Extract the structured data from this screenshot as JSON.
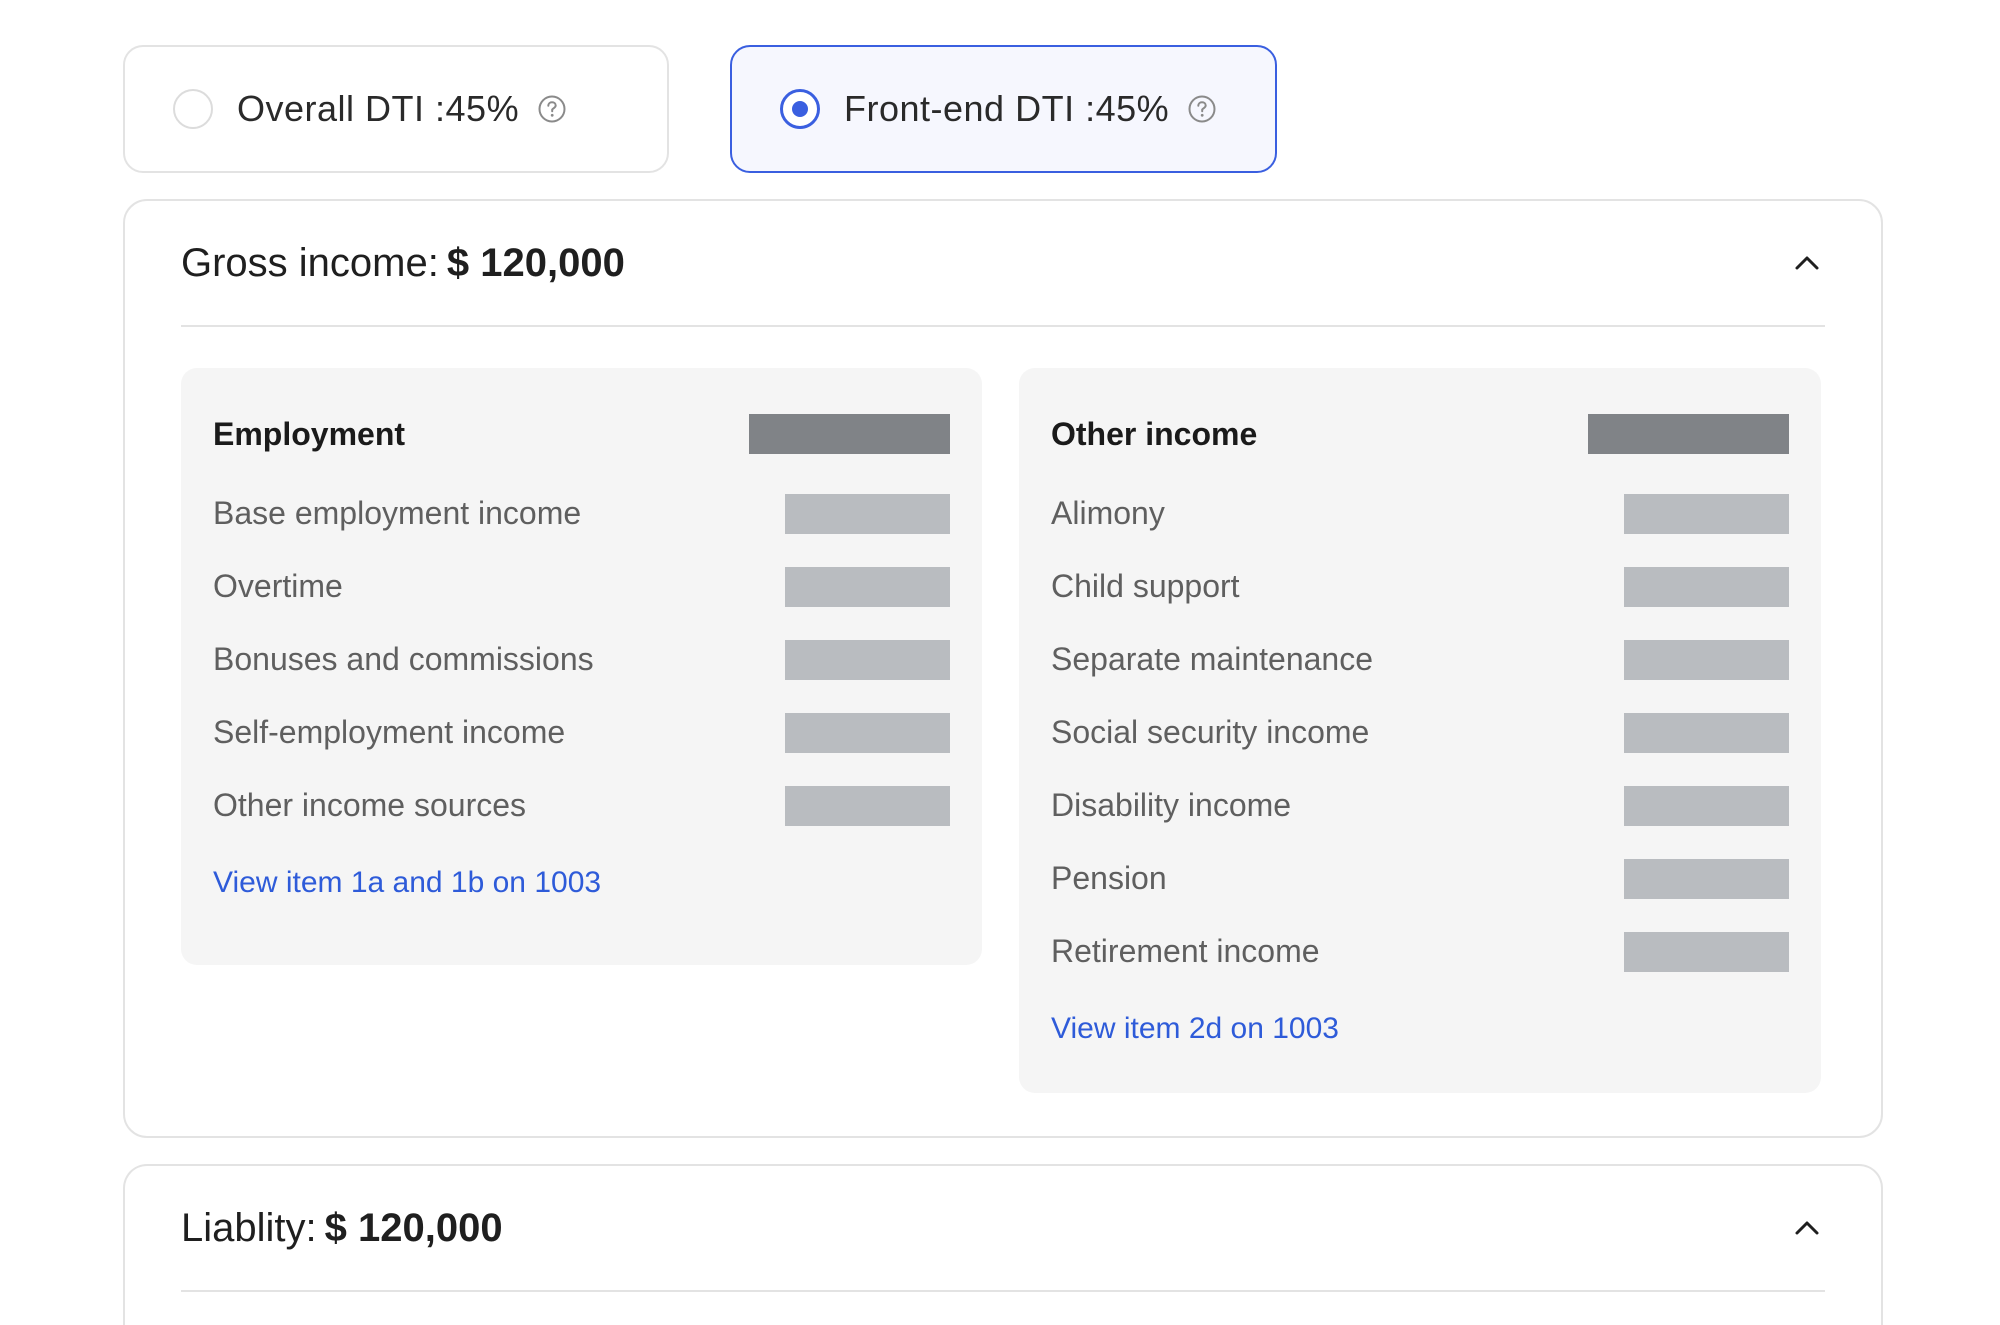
{
  "dti_options": {
    "overall": {
      "label": "Overall DTI :45%",
      "selected": false
    },
    "front_end": {
      "label": "Front-end DTI :45%",
      "selected": true
    }
  },
  "gross_income": {
    "title": "Gross income:",
    "amount": "$ 120,000",
    "employment": {
      "heading": "Employment",
      "items": [
        {
          "label": "Base employment income"
        },
        {
          "label": "Overtime"
        },
        {
          "label": "Bonuses and commissions"
        },
        {
          "label": "Self-employment income"
        },
        {
          "label": "Other income sources"
        }
      ],
      "link": "View item 1a and 1b on 1003"
    },
    "other_income": {
      "heading": "Other income",
      "items": [
        {
          "label": "Alimony"
        },
        {
          "label": "Child support"
        },
        {
          "label": "Separate maintenance"
        },
        {
          "label": "Social security income"
        },
        {
          "label": "Disability income"
        },
        {
          "label": "Pension"
        },
        {
          "label": "Retirement income"
        }
      ],
      "link": "View item 2d on 1003"
    }
  },
  "liability": {
    "title": "Liablity:",
    "amount": "$ 120,000"
  },
  "colors": {
    "accent": "#3a5fe0",
    "link": "#2e5bd9",
    "placeholder_dark": "#808387",
    "placeholder_light": "#b9bcc0"
  }
}
